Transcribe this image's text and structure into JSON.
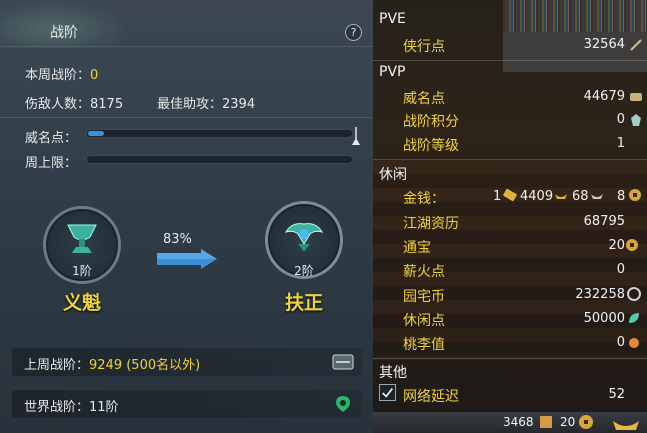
{
  "left": {
    "title": "战阶",
    "help": "?",
    "weekly_rank_label": "本周战阶：",
    "weekly_rank_value": "0",
    "kills_label": "伤敌人数：",
    "kills_value": "8175",
    "best_assist_label": "最佳助攻：",
    "best_assist_value": "2394",
    "fame_label": "威名点：",
    "fame_progress": 0.06,
    "weekly_cap_label": "周上限：",
    "weekly_cap_progress": 0,
    "progress_percent": "83%",
    "current_tier": "1阶",
    "current_rank": "义魁",
    "next_tier": "2阶",
    "next_rank": "扶正",
    "last_week_label": "上周战阶：",
    "last_week_value": "9249 (500名以外)",
    "world_rank_label": "世界战阶：",
    "world_rank_value": "11阶"
  },
  "right": {
    "sections": {
      "pve": "PVE",
      "pvp": "PVP",
      "leisure": "休闲",
      "other": "其他"
    },
    "pve_items": [
      {
        "label": "侠行点",
        "value": "32564"
      }
    ],
    "pvp_items": [
      {
        "label": "威名点",
        "value": "44679"
      },
      {
        "label": "战阶积分",
        "value": "0"
      },
      {
        "label": "战阶等级",
        "value": "1"
      }
    ],
    "money": {
      "label": "金钱：",
      "gold": "1",
      "silver": "4409",
      "copper": "68",
      "extra": "8"
    },
    "leisure_items": [
      {
        "label": "江湖资历",
        "value": "68795"
      },
      {
        "label": "通宝",
        "value": "20"
      },
      {
        "label": "薪火点",
        "value": "0"
      },
      {
        "label": "园宅币",
        "value": "232258"
      },
      {
        "label": "休闲点",
        "value": "50000"
      },
      {
        "label": "桃李值",
        "value": "0"
      }
    ],
    "other_items": [
      {
        "label": "网络延迟",
        "value": "52",
        "checked": true
      }
    ],
    "bottom": {
      "value_a": "3468",
      "value_b": "20"
    },
    "bg_level": "130"
  },
  "colors": {
    "accent_yellow": "#f0d33a",
    "progress_blue": "#3d8fd8"
  }
}
